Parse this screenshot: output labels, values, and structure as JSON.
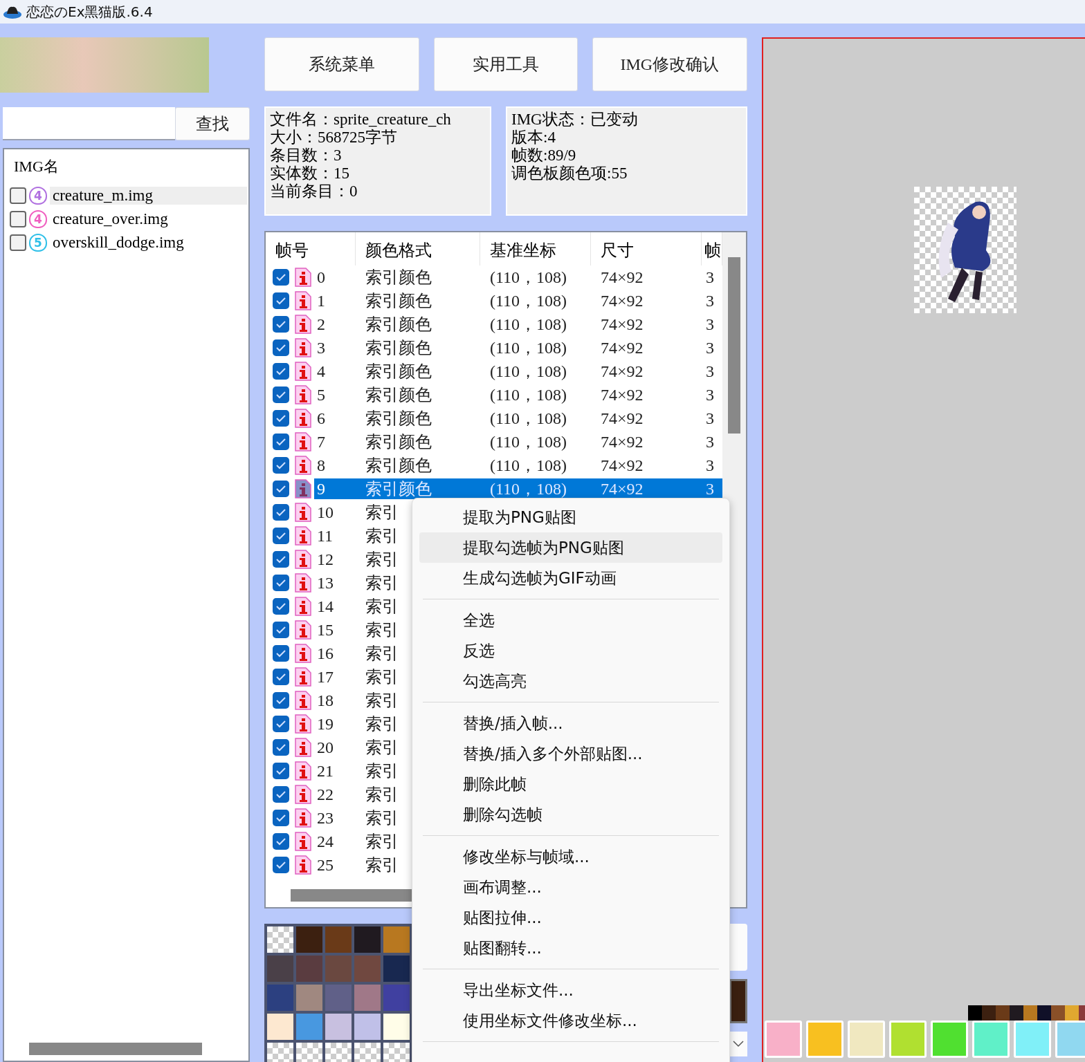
{
  "window": {
    "title": "恋恋のEx黑猫版.6.4"
  },
  "search": {
    "button": "查找"
  },
  "img_list": {
    "header": "IMG名",
    "items": [
      {
        "name": "creature_m.img",
        "badge": "4",
        "color": "#b070e0",
        "checked": false,
        "selected": true
      },
      {
        "name": "creature_over.img",
        "badge": "4",
        "color": "#f060c0",
        "checked": false,
        "selected": false
      },
      {
        "name": "overskill_dodge.img",
        "badge": "5",
        "color": "#30c0e8",
        "checked": false,
        "selected": false
      }
    ]
  },
  "toolbar": [
    "系统菜单",
    "实用工具",
    "IMG修改确认"
  ],
  "file_info": [
    "文件名：sprite_creature_ch",
    "大小：568725字节",
    "条目数：3",
    "实体数：15",
    "当前条目：0"
  ],
  "img_info": [
    "IMG状态：已变动",
    "版本:4",
    "帧数:89/9",
    "调色板颜色项:55"
  ],
  "frames": {
    "columns": [
      "帧号",
      "颜色格式",
      "基准坐标",
      "尺寸",
      "帧"
    ],
    "rows": [
      {
        "checked": true,
        "selected": false,
        "cells": [
          "0",
          "索引颜色",
          "(110，108)",
          "74×92",
          "3"
        ]
      },
      {
        "checked": true,
        "selected": false,
        "cells": [
          "1",
          "索引颜色",
          "(110，108)",
          "74×92",
          "3"
        ]
      },
      {
        "checked": true,
        "selected": false,
        "cells": [
          "2",
          "索引颜色",
          "(110，108)",
          "74×92",
          "3"
        ]
      },
      {
        "checked": true,
        "selected": false,
        "cells": [
          "3",
          "索引颜色",
          "(110，108)",
          "74×92",
          "3"
        ]
      },
      {
        "checked": true,
        "selected": false,
        "cells": [
          "4",
          "索引颜色",
          "(110，108)",
          "74×92",
          "3"
        ]
      },
      {
        "checked": true,
        "selected": false,
        "cells": [
          "5",
          "索引颜色",
          "(110，108)",
          "74×92",
          "3"
        ]
      },
      {
        "checked": true,
        "selected": false,
        "cells": [
          "6",
          "索引颜色",
          "(110，108)",
          "74×92",
          "3"
        ]
      },
      {
        "checked": true,
        "selected": false,
        "cells": [
          "7",
          "索引颜色",
          "(110，108)",
          "74×92",
          "3"
        ]
      },
      {
        "checked": true,
        "selected": false,
        "cells": [
          "8",
          "索引颜色",
          "(110，108)",
          "74×92",
          "3"
        ]
      },
      {
        "checked": true,
        "selected": true,
        "cells": [
          "9",
          "索引颜色",
          "(110，108)",
          "74×92",
          "3"
        ]
      },
      {
        "checked": true,
        "selected": false,
        "cells": [
          "10",
          "索引"
        ]
      },
      {
        "checked": true,
        "selected": false,
        "cells": [
          "11",
          "索引"
        ]
      },
      {
        "checked": true,
        "selected": false,
        "cells": [
          "12",
          "索引"
        ]
      },
      {
        "checked": true,
        "selected": false,
        "cells": [
          "13",
          "索引"
        ]
      },
      {
        "checked": true,
        "selected": false,
        "cells": [
          "14",
          "索引"
        ]
      },
      {
        "checked": true,
        "selected": false,
        "cells": [
          "15",
          "索引"
        ]
      },
      {
        "checked": true,
        "selected": false,
        "cells": [
          "16",
          "索引"
        ]
      },
      {
        "checked": true,
        "selected": false,
        "cells": [
          "17",
          "索引"
        ]
      },
      {
        "checked": true,
        "selected": false,
        "cells": [
          "18",
          "索引"
        ]
      },
      {
        "checked": true,
        "selected": false,
        "cells": [
          "19",
          "索引"
        ]
      },
      {
        "checked": true,
        "selected": false,
        "cells": [
          "20",
          "索引"
        ]
      },
      {
        "checked": true,
        "selected": false,
        "cells": [
          "21",
          "索引"
        ]
      },
      {
        "checked": true,
        "selected": false,
        "cells": [
          "22",
          "索引"
        ]
      },
      {
        "checked": true,
        "selected": false,
        "cells": [
          "23",
          "索引"
        ]
      },
      {
        "checked": true,
        "selected": false,
        "cells": [
          "24",
          "索引"
        ]
      },
      {
        "checked": true,
        "selected": false,
        "cells": [
          "25",
          "索引"
        ]
      }
    ]
  },
  "palette": [
    {
      "kind": "transparent"
    },
    {
      "kind": "color",
      "color": "#3c2010"
    },
    {
      "kind": "color",
      "color": "#6a3a18"
    },
    {
      "kind": "color",
      "color": "#201a20"
    },
    {
      "kind": "color",
      "color": "#b87820"
    },
    {
      "kind": "color",
      "color": "#4a4048"
    },
    {
      "kind": "color",
      "color": "#5a3c40"
    },
    {
      "kind": "color",
      "color": "#6a4840"
    },
    {
      "kind": "color",
      "color": "#704840"
    },
    {
      "kind": "color",
      "color": "#182850"
    },
    {
      "kind": "color",
      "color": "#2c4080"
    },
    {
      "kind": "color",
      "color": "#a08880"
    },
    {
      "kind": "color",
      "color": "#606088"
    },
    {
      "kind": "color",
      "color": "#a07888"
    },
    {
      "kind": "color",
      "color": "#4040a0"
    },
    {
      "kind": "color",
      "color": "#fde8d0"
    },
    {
      "kind": "color",
      "color": "#4898e0"
    },
    {
      "kind": "color",
      "color": "#c8c0e0"
    },
    {
      "kind": "color",
      "color": "#c0c0e8"
    },
    {
      "kind": "color",
      "color": "#fffde8"
    },
    {
      "kind": "transparent"
    },
    {
      "kind": "transparent"
    },
    {
      "kind": "transparent"
    },
    {
      "kind": "transparent"
    },
    {
      "kind": "transparent"
    }
  ],
  "current_color": {
    "color": "#3a2010"
  },
  "canvas": {
    "color_strip": [
      {
        "color": "#000000"
      },
      {
        "color": "#3c2010"
      },
      {
        "color": "#6a3a18"
      },
      {
        "color": "#201a20"
      },
      {
        "color": "#b87820"
      },
      {
        "color": "#101028"
      },
      {
        "color": "#8a5028"
      },
      {
        "color": "#e0a830"
      },
      {
        "color": "#8a3a3a"
      }
    ]
  },
  "context_menu": {
    "groups": [
      [
        {
          "label": "提取为PNG贴图",
          "selected": false
        },
        {
          "label": "提取勾选帧为PNG贴图",
          "selected": true
        },
        {
          "label": "生成勾选帧为GIF动画",
          "selected": false
        }
      ],
      [
        {
          "label": "全选",
          "selected": false
        },
        {
          "label": "反选",
          "selected": false
        },
        {
          "label": "勾选高亮",
          "selected": false
        }
      ],
      [
        {
          "label": "替换/插入帧...",
          "selected": false
        },
        {
          "label": "替换/插入多个外部贴图...",
          "selected": false
        },
        {
          "label": "删除此帧",
          "selected": false
        },
        {
          "label": "删除勾选帧",
          "selected": false
        }
      ],
      [
        {
          "label": "修改坐标与帧域...",
          "selected": false
        },
        {
          "label": "画布调整...",
          "selected": false
        },
        {
          "label": "贴图拉伸...",
          "selected": false
        },
        {
          "label": "贴图翻转...",
          "selected": false
        }
      ],
      [
        {
          "label": "导出坐标文件...",
          "selected": false
        },
        {
          "label": "使用坐标文件修改坐标...",
          "selected": false
        }
      ]
    ]
  }
}
